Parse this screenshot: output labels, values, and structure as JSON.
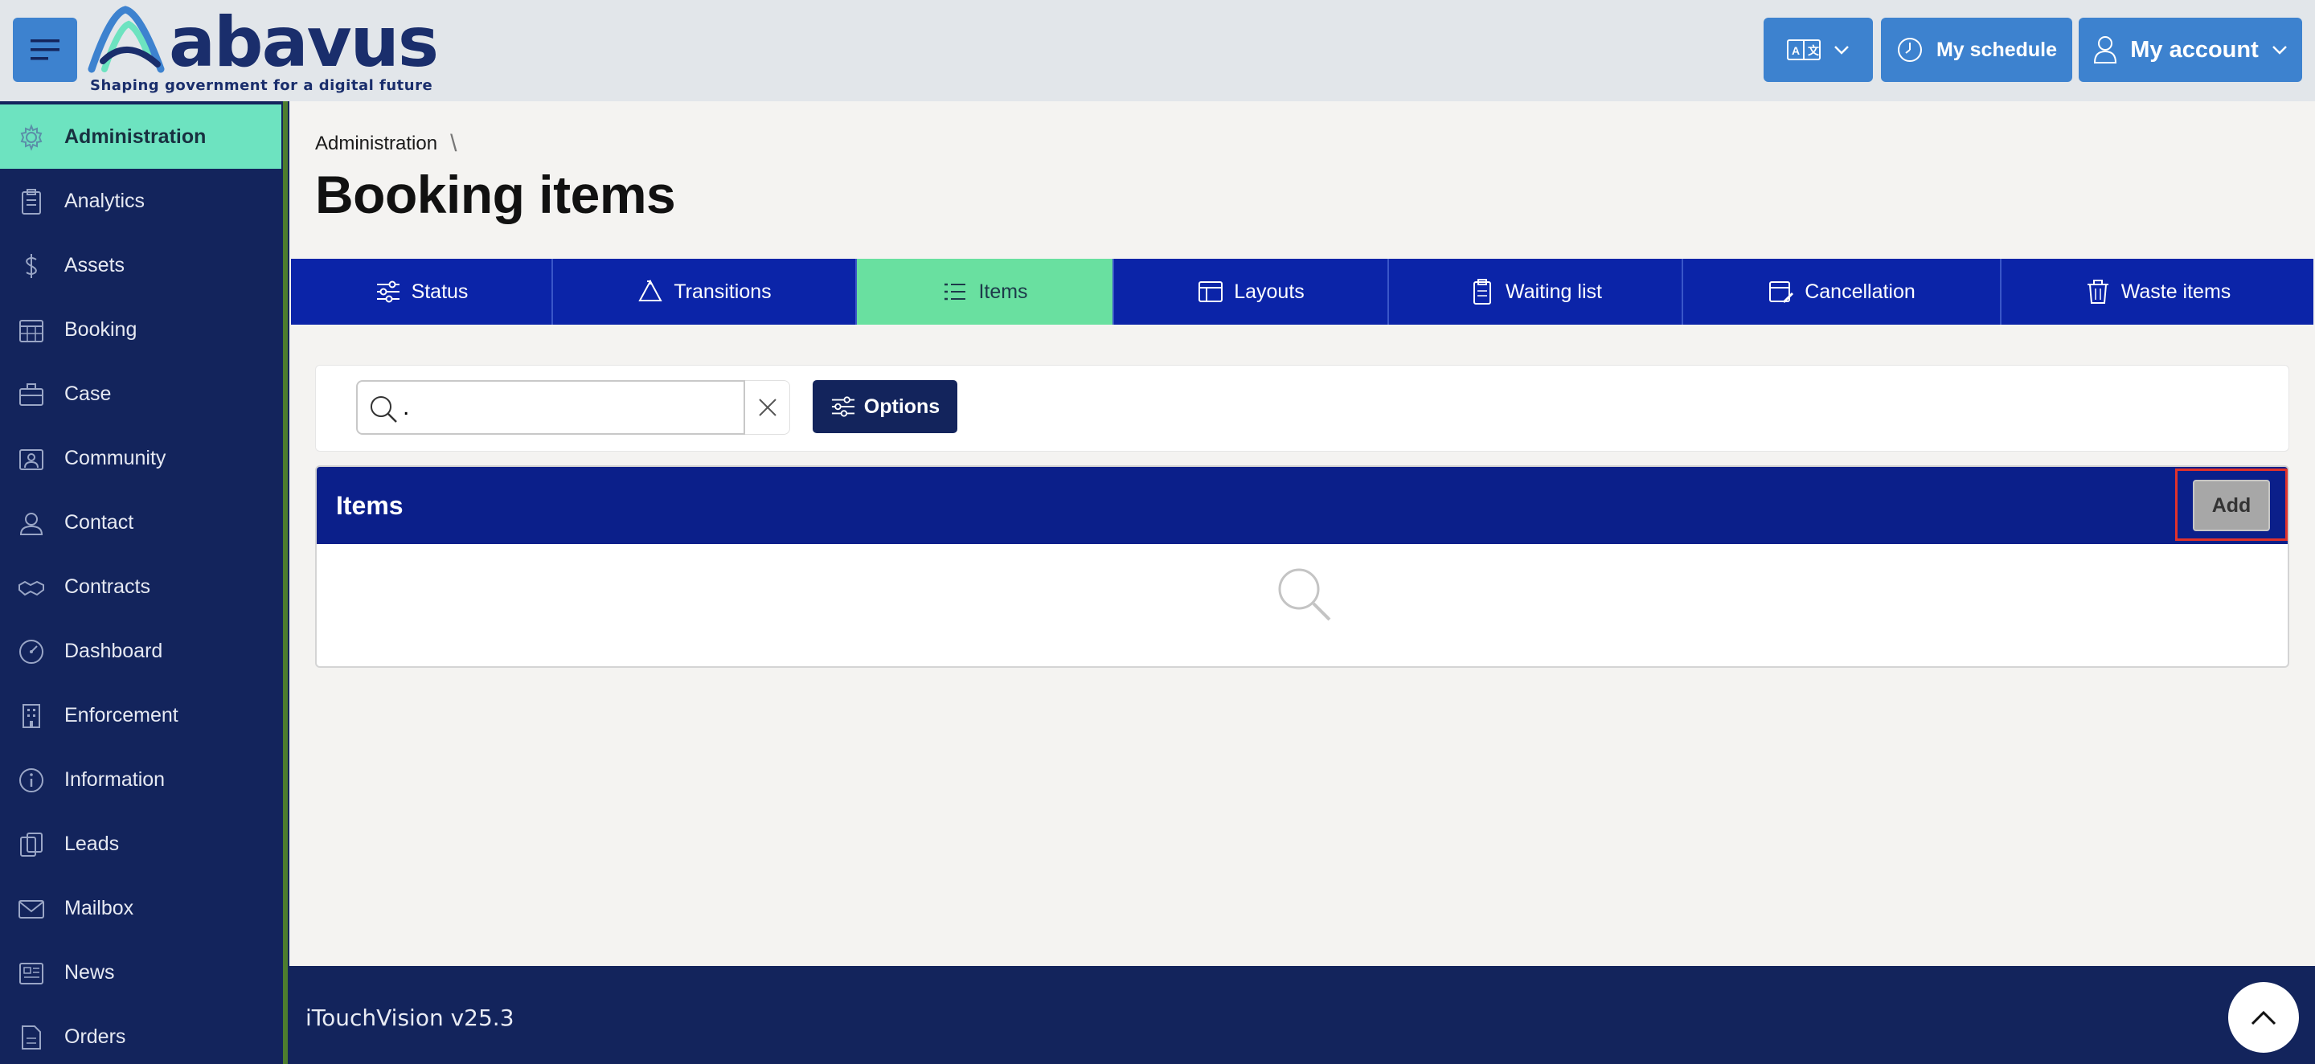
{
  "header": {
    "logo_text": "abavus",
    "logo_tagline": "Shaping government for a digital future",
    "schedule_label": "My schedule",
    "account_label": "My account"
  },
  "sidebar": {
    "items": [
      {
        "label": "Administration",
        "icon": "gear-icon",
        "active": true
      },
      {
        "label": "Analytics",
        "icon": "clipboard-icon"
      },
      {
        "label": "Assets",
        "icon": "dollar-icon"
      },
      {
        "label": "Booking",
        "icon": "calendar-grid-icon"
      },
      {
        "label": "Case",
        "icon": "briefcase-icon"
      },
      {
        "label": "Community",
        "icon": "people-icon"
      },
      {
        "label": "Contact",
        "icon": "person-badge-icon"
      },
      {
        "label": "Contracts",
        "icon": "handshake-icon"
      },
      {
        "label": "Dashboard",
        "icon": "gauge-icon"
      },
      {
        "label": "Enforcement",
        "icon": "building-icon"
      },
      {
        "label": "Information",
        "icon": "info-icon"
      },
      {
        "label": "Leads",
        "icon": "copy-icon"
      },
      {
        "label": "Mailbox",
        "icon": "envelope-icon"
      },
      {
        "label": "News",
        "icon": "newspaper-icon"
      },
      {
        "label": "Orders",
        "icon": "document-icon"
      }
    ]
  },
  "breadcrumb": {
    "root": "Administration",
    "separator": "\\"
  },
  "page": {
    "title": "Booking items"
  },
  "tabs": [
    {
      "label": "Status",
      "icon": "sliders-icon"
    },
    {
      "label": "Transitions",
      "icon": "recycle-icon"
    },
    {
      "label": "Items",
      "icon": "list-icon",
      "active": true
    },
    {
      "label": "Layouts",
      "icon": "layout-icon"
    },
    {
      "label": "Waiting list",
      "icon": "clipboard-icon"
    },
    {
      "label": "Cancellation",
      "icon": "calendar-edit-icon"
    },
    {
      "label": "Waste items",
      "icon": "trash-icon"
    }
  ],
  "search": {
    "value": "."
  },
  "toolbar": {
    "options_label": "Options"
  },
  "panel": {
    "title": "Items",
    "add_label": "Add"
  },
  "footer": {
    "version": "iTouchVision v25.3"
  },
  "colors": {
    "brand_blue": "#3d82cf",
    "sidebar_navy": "#13245c",
    "tab_blue": "#0b24a8",
    "active_green": "#69e0a0",
    "highlight_red": "#e0322b"
  }
}
